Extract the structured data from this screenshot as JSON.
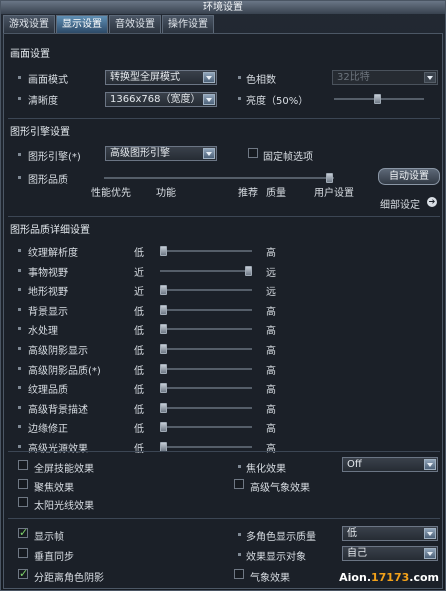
{
  "window": {
    "title": "环境设置"
  },
  "tabs": [
    "游戏设置",
    "显示设置",
    "音效设置",
    "操作设置"
  ],
  "screen": {
    "title": "画面设置",
    "mode_label": "画面模式",
    "mode_value": "转换型全屏模式",
    "color_label": "色相数",
    "color_value": "32比特",
    "resolution_label": "清晰度",
    "resolution_value": "1366x768（宽度）",
    "brightness_label": "亮度（50%）",
    "brightness": 0.5
  },
  "engine": {
    "title": "图形引擎设置",
    "engine_label": "图形引擎(*)",
    "engine_value": "高级图形引擎",
    "fixed_frame_label": "固定帧选项",
    "fixed_frame_checked": false,
    "quality_label": "图形品质",
    "auto_button": "自动设置",
    "quality_marks": [
      "性能优先",
      "功能",
      "推荐",
      "质量",
      "用户设置"
    ],
    "quality_level": 1.0,
    "detail_link": "细部设定"
  },
  "detail": {
    "title": "图形品质详细设置",
    "rows": [
      {
        "label": "纹理解析度",
        "low": "低",
        "high": "高",
        "level": 0.0
      },
      {
        "label": "事物视野",
        "low": "近",
        "high": "远",
        "level": 1.0
      },
      {
        "label": "地形视野",
        "low": "近",
        "high": "远",
        "level": 0.0
      },
      {
        "label": "背景显示",
        "low": "低",
        "high": "高",
        "level": 0.0
      },
      {
        "label": "水处理",
        "low": "低",
        "high": "高",
        "level": 0.0
      },
      {
        "label": "高级阴影显示",
        "low": "低",
        "high": "高",
        "level": 0.0
      },
      {
        "label": "高级阴影品质(*)",
        "low": "低",
        "high": "高",
        "level": 0.0
      },
      {
        "label": "纹理品质",
        "low": "低",
        "high": "高",
        "level": 0.0
      },
      {
        "label": "高级背景描述",
        "low": "低",
        "high": "高",
        "level": 0.0
      },
      {
        "label": "边缘修正",
        "low": "低",
        "high": "高",
        "level": 0.0
      },
      {
        "label": "高级光源效果",
        "low": "低",
        "high": "高",
        "level": 0.0
      }
    ]
  },
  "effects": {
    "fullscreen_skill": "全屏技能效果",
    "blur_label": "焦化效果",
    "blur_value": "Off",
    "focus": "聚焦效果",
    "weather_high": "高级气象效果",
    "sunlight": "太阳光线效果"
  },
  "bottom": {
    "show_frame": "显示帧",
    "vsync": "垂直同步",
    "distance_shadow": "分距离角色阴影",
    "multi_char_label": "多角色显示质量",
    "multi_char_value": "低",
    "effect_target_label": "效果显示对象",
    "effect_target_value": "自己",
    "weather_effect": "气象效果"
  },
  "watermark": {
    "prefix": "Aion.",
    "number": "17173",
    "suffix": ".com"
  },
  "icons": {
    "dropdown": "chevron-down-icon",
    "detail": "arrow-right-icon",
    "check": "check-icon"
  }
}
